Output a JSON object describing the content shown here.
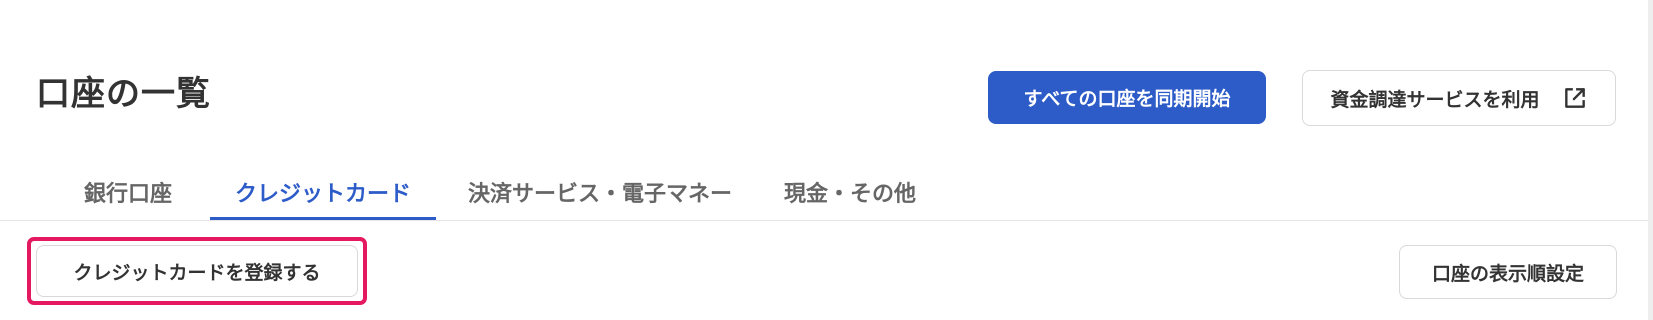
{
  "header": {
    "title": "口座の一覧",
    "sync_button_label": "すべての口座を同期開始",
    "funding_button_label": "資金調達サービスを利用",
    "funding_button_icon": "external-link-icon"
  },
  "tabs": [
    {
      "label": "銀行口座",
      "active": false
    },
    {
      "label": "クレジットカード",
      "active": true
    },
    {
      "label": "決済サービス・電子マネー",
      "active": false
    },
    {
      "label": "現金・その他",
      "active": false
    }
  ],
  "toolbar": {
    "register_button_label": "クレジットカードを登録する",
    "order_button_label": "口座の表示順設定"
  },
  "colors": {
    "primary": "#2d5cc9",
    "highlight": "#e5195f",
    "text": "#333333",
    "tab_inactive": "#666666"
  }
}
